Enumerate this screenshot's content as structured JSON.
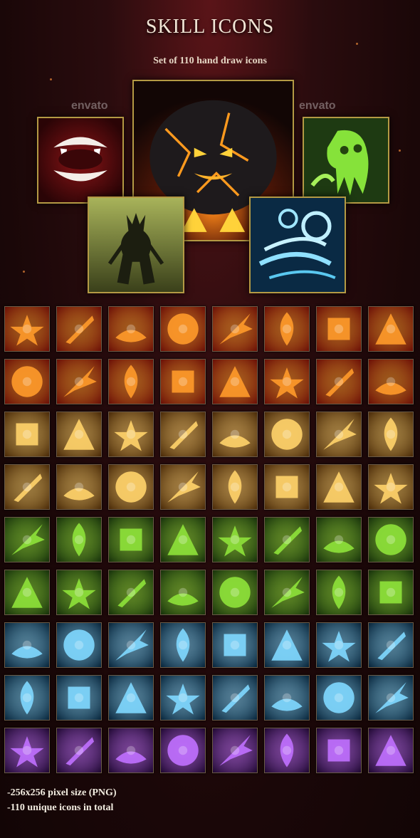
{
  "header": {
    "title": "SKILL ICONS",
    "subtitle": "Set of 110 hand draw icons"
  },
  "watermark": "envato",
  "hero_icons": [
    {
      "name": "fangs-icon"
    },
    {
      "name": "lava-golem-icon"
    },
    {
      "name": "green-ghost-icon"
    },
    {
      "name": "treant-icon"
    },
    {
      "name": "wind-gust-icon"
    }
  ],
  "icon_rows": [
    {
      "theme": "fire",
      "icons": [
        "pentagram-icon",
        "bloody-blade-icon",
        "lava-pit-icon",
        "meteor-shower-icon",
        "fire-streak-icon",
        "cracked-earth-icon",
        "sun-burst-icon",
        "flames-icon"
      ]
    },
    {
      "theme": "fire",
      "icons": [
        "fire-whip-icon",
        "fire-pillar-icon",
        "blood-drops-icon",
        "fire-rain-icon",
        "fireball-icon",
        "fire-arrows-icon",
        "return-arrow-icon",
        "winged-boot-icon"
      ]
    },
    {
      "theme": "gold",
      "icons": [
        "voodoo-doll-icon",
        "stun-stars-icon",
        "target-icon",
        "keyhole-icon",
        "coin-bag-icon",
        "eye-icon",
        "spear-light-icon",
        "triple-spear-icon"
      ]
    },
    {
      "theme": "gold",
      "icons": [
        "fist-icon",
        "broken-shield-icon",
        "lightning-sword-icon",
        "wooden-shield-icon",
        "hourglass-icon",
        "aura-silhouette-icon",
        "glowing-hand-icon",
        "magnifier-eye-icon"
      ]
    },
    {
      "theme": "nature",
      "icons": [
        "ground-spikes-icon",
        "stone-pillar-icon",
        "dark-treant-icon",
        "earth-fist-icon",
        "earth-rise-icon",
        "stone-golem-icon",
        "vine-tendril-icon",
        "leaf-icon"
      ]
    },
    {
      "theme": "nature",
      "icons": [
        "heal-cross-icon",
        "clover-icon",
        "slime-icon",
        "poison-drops-icon",
        "ghost-tentacle-icon",
        "skull-crossbones-icon",
        "poison-cloud-icon",
        "skulls-icon"
      ]
    },
    {
      "theme": "ice",
      "icons": [
        "ice-vortex-icon",
        "lightning-icon",
        "ice-shards-icon",
        "ice-crystals-icon",
        "tidal-wave-icon",
        "blizzard-icon",
        "bubbles-icon",
        "ice-golem-icon"
      ]
    },
    {
      "theme": "ice",
      "icons": [
        "planet-icon",
        "full-moon-icon",
        "frost-beam-icon",
        "stone-heart-icon",
        "bright-eye-icon",
        "frost-tree-icon",
        "water-swirl-icon",
        "light-pillar-icon"
      ]
    },
    {
      "theme": "arcane",
      "icons": [
        "scarecrow-icon",
        "tombstone-cross-icon",
        "void-orb-icon",
        "black-hole-icon",
        "shadow-hand-icon",
        "golden-chalice-icon",
        "arcane-lightning-icon",
        "spirit-gust-icon"
      ]
    }
  ],
  "footer": {
    "line1": "-256x256 pixel size (PNG)",
    "line2": "-110 unique icons in total"
  },
  "colors": {
    "frame": "#b49a44",
    "fire": [
      "#ff9a2a",
      "#6a0e06"
    ],
    "gold": [
      "#ffd36a",
      "#4a2a08"
    ],
    "nature": [
      "#8ee23a",
      "#16300a"
    ],
    "ice": [
      "#7fd8ff",
      "#07243a"
    ],
    "arcane": [
      "#c070ff",
      "#1e0730"
    ]
  }
}
